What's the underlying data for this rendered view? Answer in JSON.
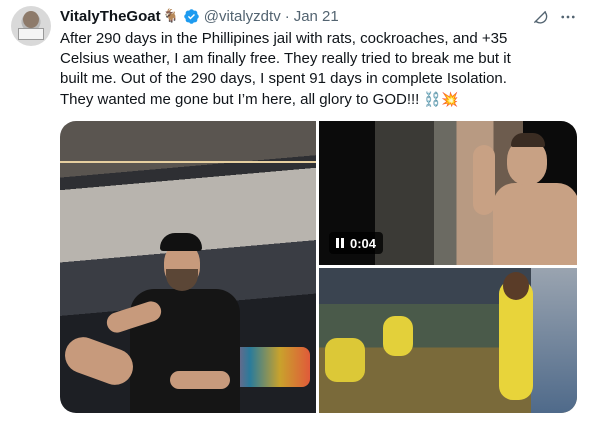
{
  "tweet": {
    "author": {
      "display_name": "VitalyTheGoat",
      "name_emoji": "🐐",
      "handle": "@vitalyzdtv",
      "separator": "·",
      "date": "Jan 21"
    },
    "text": "After 290 days in the Phillipines jail with rats, cockroaches, and +35 Celsius weather, I am finally free. They really tried to break me but it built me. Out of the 290 days, I spent 91 days in complete Isolation. They wanted me gone but I’m here, all glory to GOD!!! ",
    "text_emojis": "⛓️💥",
    "media": {
      "video": {
        "duration_label": "0:04"
      }
    }
  },
  "colors": {
    "text": "#0f1419",
    "secondary": "#536471",
    "verified_blue": "#1d9bf0"
  },
  "icons": [
    "verified-badge-icon",
    "grok-icon",
    "more-icon",
    "pause-icon"
  ]
}
